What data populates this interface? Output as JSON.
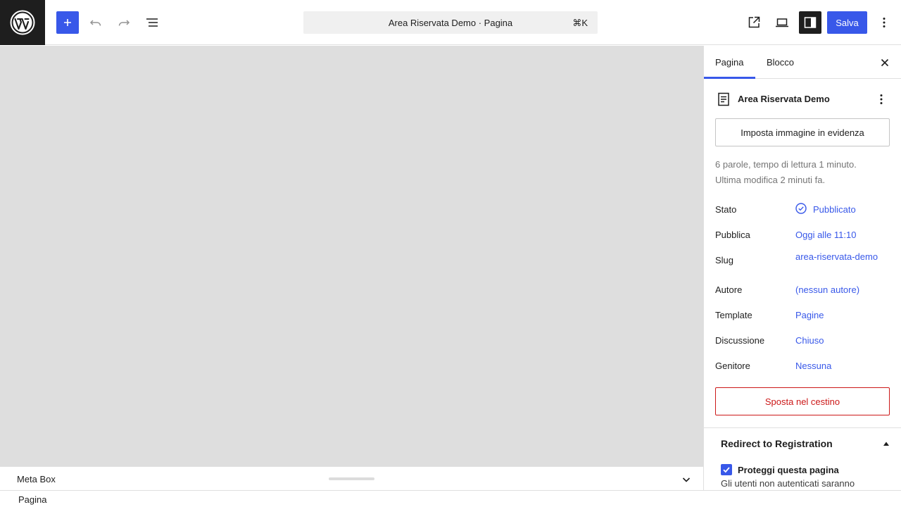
{
  "header": {
    "document_title": "Area Riservata Demo · Pagina",
    "shortcut": "⌘K",
    "save_label": "Salva",
    "icons": {
      "logo": "wordpress-icon",
      "add": "plus-icon",
      "undo": "undo-icon",
      "redo": "redo-icon",
      "list_view": "list-view-icon",
      "view": "external-link-icon",
      "device": "laptop-icon",
      "settings": "sidebar-icon",
      "options": "more-vertical-icon"
    }
  },
  "metabox": {
    "label": "Meta Box"
  },
  "footer": {
    "breadcrumb": "Pagina"
  },
  "sidebar": {
    "tabs": [
      {
        "label": "Pagina",
        "active": true
      },
      {
        "label": "Blocco",
        "active": false
      }
    ],
    "document": {
      "title": "Area Riservata Demo",
      "featured_image_button": "Imposta immagine in evidenza",
      "word_info": "6 parole, tempo di lettura 1 minuto.",
      "last_modified": "Ultima modifica 2 minuti fa."
    },
    "rows": [
      {
        "label": "Stato",
        "value": "Pubblicato"
      },
      {
        "label": "Pubblica",
        "value": "Oggi alle 11:10"
      },
      {
        "label": "Slug",
        "value": "area-riservata-demo"
      },
      {
        "label": "Autore",
        "value": "(nessun autore)"
      },
      {
        "label": "Template",
        "value": "Pagine"
      },
      {
        "label": "Discussione",
        "value": "Chiuso"
      },
      {
        "label": "Genitore",
        "value": "Nessuna"
      }
    ],
    "trash_button": "Sposta nel cestino",
    "redirect_panel": {
      "title": "Redirect to Registration",
      "checkbox_label": "Proteggi questa pagina",
      "checked": true,
      "help": "Gli utenti non autenticati saranno"
    }
  },
  "colors": {
    "accent": "#3858e9",
    "danger": "#cc1818",
    "canvas": "#dedede"
  }
}
